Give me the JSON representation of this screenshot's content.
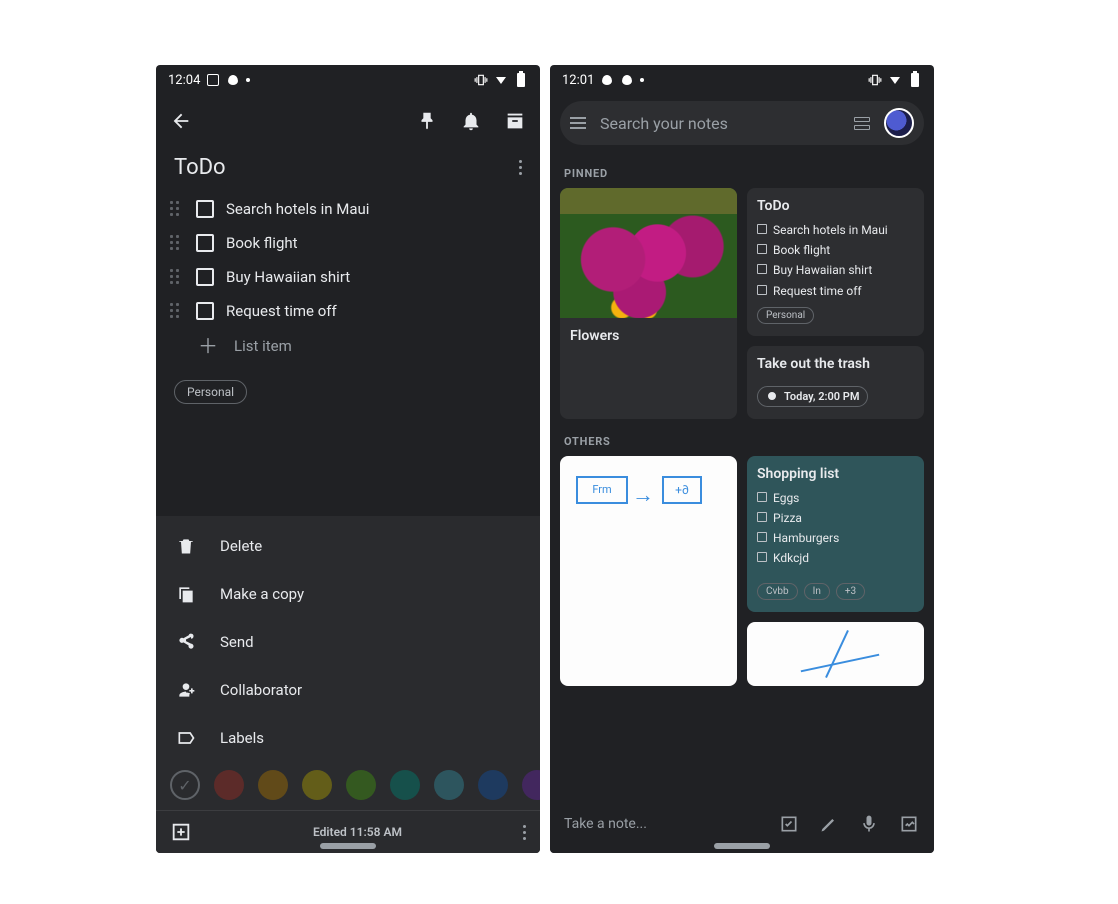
{
  "left": {
    "status": {
      "time": "12:04"
    },
    "note": {
      "title": "ToDo",
      "items": [
        "Search hotels in Maui",
        "Book flight",
        "Buy Hawaiian shirt",
        "Request time off"
      ],
      "add_placeholder": "List item",
      "label_chip": "Personal"
    },
    "menu": {
      "items": [
        "Delete",
        "Make a copy",
        "Send",
        "Collaborator",
        "Labels"
      ],
      "colors": [
        "#5c2b29",
        "#614a19",
        "#635d19",
        "#345920",
        "#16504b",
        "#2d555e",
        "#1e3a5f",
        "#42275e"
      ]
    },
    "footer": {
      "edited": "Edited 11:58 AM"
    }
  },
  "right": {
    "status": {
      "time": "12:01"
    },
    "search_placeholder": "Search your notes",
    "sections": {
      "pinned": "PINNED",
      "others": "OTHERS"
    },
    "pinned": {
      "flowers": {
        "title": "Flowers"
      },
      "todo": {
        "title": "ToDo",
        "items": [
          "Search hotels in Maui",
          "Book flight",
          "Buy Hawaiian shirt",
          "Request time off"
        ],
        "chip": "Personal"
      },
      "trash": {
        "title": "Take out the trash",
        "reminder": "Today, 2:00 PM"
      }
    },
    "others": {
      "sketch_box1": "Frm",
      "sketch_box2": "+∂",
      "shopping": {
        "title": "Shopping list",
        "items": [
          "Eggs",
          "Pizza",
          "Hamburgers",
          "Kdkcjd"
        ],
        "chips": [
          "Cvbb",
          "In",
          "+3"
        ]
      }
    },
    "take_note": "Take a note..."
  }
}
